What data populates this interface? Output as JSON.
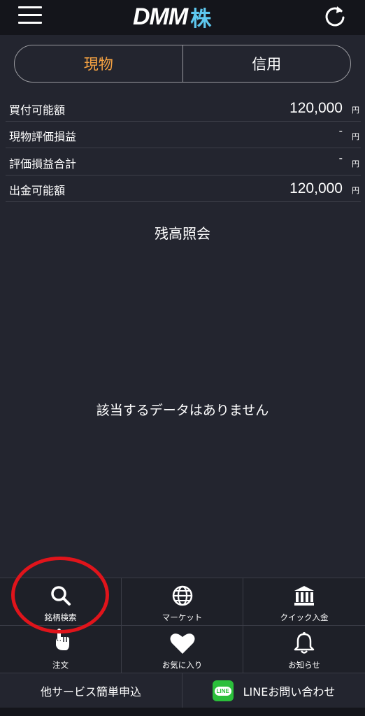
{
  "header": {
    "logo_main": "DMM",
    "logo_sub": "株"
  },
  "tabs": [
    {
      "label": "現物",
      "active": true
    },
    {
      "label": "信用",
      "active": false
    }
  ],
  "summary": [
    {
      "label": "買付可能額",
      "value": "120,000",
      "unit": "円"
    },
    {
      "label": "現物評価損益",
      "value": "-",
      "unit": "円"
    },
    {
      "label": "評価損益合計",
      "value": "-",
      "unit": "円"
    },
    {
      "label": "出金可能額",
      "value": "120,000",
      "unit": "円"
    }
  ],
  "section_title": "残高照会",
  "empty_message": "該当するデータはありません",
  "nav": [
    {
      "label": "銘柄検索",
      "icon": "search-icon"
    },
    {
      "label": "マーケット",
      "icon": "globe-icon"
    },
    {
      "label": "クイック入金",
      "icon": "bank-icon"
    },
    {
      "label": "注文",
      "icon": "hand-pointer-icon"
    },
    {
      "label": "お気に入り",
      "icon": "heart-icon"
    },
    {
      "label": "お知らせ",
      "icon": "bell-icon"
    }
  ],
  "footer": {
    "left_label": "他サービス簡単申込",
    "line_badge": "LINE",
    "right_label": "LINEお問い合わせ"
  },
  "colors": {
    "background": "#23252f",
    "header": "#14151b",
    "active_tab": "#f5a242",
    "logo_accent": "#5ec8ef",
    "line_green": "#2bbf3b",
    "highlight": "#e0141b"
  }
}
